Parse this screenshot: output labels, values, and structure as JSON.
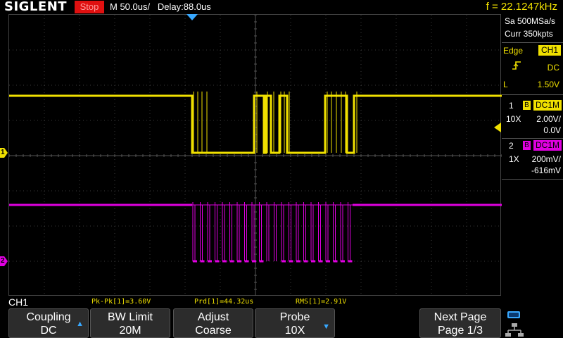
{
  "topbar": {
    "logo": "SIGLENT",
    "run_status": "Stop",
    "timebase": "M 50.0us/   Delay:88.0us",
    "frequency": "f = 22.1247kHz"
  },
  "acquisition": {
    "sample_rate": "Sa 500MSa/s",
    "memory": "Curr 350kpts"
  },
  "trigger": {
    "mode": "Edge",
    "source": "CH1",
    "coupling": "DC",
    "level_label": "L",
    "level": "1.50V",
    "slope_icon": "rising-edge-icon"
  },
  "channels": [
    {
      "num": "1",
      "bw_mark": "B",
      "coupling": "DC1M",
      "probe": "10X",
      "scale": "2.00V/",
      "offset": "0.0V",
      "color": "#f0e000"
    },
    {
      "num": "2",
      "bw_mark": "B",
      "coupling": "DC1M",
      "probe": "1X",
      "scale": "200mV/",
      "offset": "-616mV",
      "color": "#e000e0"
    }
  ],
  "markers": {
    "ch1": "1",
    "ch2": "2"
  },
  "measurements": {
    "channel": "CH1",
    "pkpk": "Pk-Pk[1]=3.60V",
    "period": "Prd[1]=44.32us",
    "rms": "RMS[1]=2.91V"
  },
  "menu": {
    "softkeys": [
      {
        "line1": "Coupling",
        "line2": "DC"
      },
      {
        "line1": "BW Limit",
        "line2": "20M"
      },
      {
        "line1": "Adjust",
        "line2": "Coarse"
      },
      {
        "line1": "Probe",
        "line2": "10X"
      },
      {
        "line1": "Next Page",
        "line2": "Page 1/3"
      }
    ]
  },
  "colors": {
    "ch1": "#f0e000",
    "ch2": "#e000e0",
    "grid": "#3a3a3a",
    "accent": "#38a8ff",
    "stop": "#e01010"
  }
}
